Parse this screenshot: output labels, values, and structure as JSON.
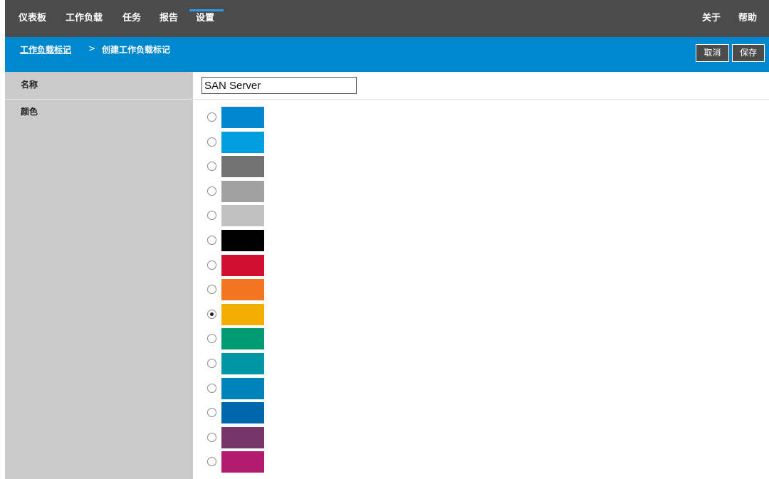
{
  "topnav": {
    "items": [
      {
        "label": "仪表板"
      },
      {
        "label": "工作负载"
      },
      {
        "label": "任务"
      },
      {
        "label": "报告"
      },
      {
        "label": "设置",
        "active": true
      }
    ],
    "right_items": [
      {
        "label": "关于"
      },
      {
        "label": "帮助"
      }
    ]
  },
  "breadcrumb": {
    "parent": "工作负载标记",
    "separator": ">",
    "current": "创建工作负载标记"
  },
  "actions": {
    "cancel_label": "取消",
    "save_label": "保存"
  },
  "form": {
    "name_label": "名称",
    "name_value": "SAN Server",
    "color_label": "颜色",
    "selected_index": 8,
    "colors": [
      "#0187d0",
      "#00a0e0",
      "#727272",
      "#a1a1a1",
      "#c1c1c1",
      "#000000",
      "#d20f30",
      "#f37522",
      "#f1ad00",
      "#009a72",
      "#0097a4",
      "#0082ba",
      "#0067ad",
      "#763668",
      "#b31b6e"
    ]
  }
}
